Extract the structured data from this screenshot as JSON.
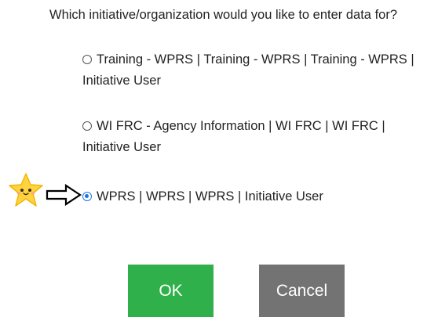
{
  "prompt": "Which initiative/organization would you like to enter data for?",
  "options": [
    {
      "label": "Training - WPRS | Training - WPRS | Training - WPRS | Initiative User",
      "selected": false
    },
    {
      "label": "WI FRC - Agency Information | WI FRC | WI FRC | Initiative User",
      "selected": false
    },
    {
      "label": "WPRS | WPRS | WPRS | Initiative User",
      "selected": true
    }
  ],
  "buttons": {
    "ok_label": "OK",
    "cancel_label": "Cancel"
  },
  "colors": {
    "ok_bg": "#2fb04a",
    "cancel_bg": "#737373",
    "radio_selected": "#1a73e8",
    "star": "#ffd23f"
  },
  "annotations": {
    "star_icon": "star-face-icon",
    "arrow_icon": "arrow-right-outline-icon"
  }
}
